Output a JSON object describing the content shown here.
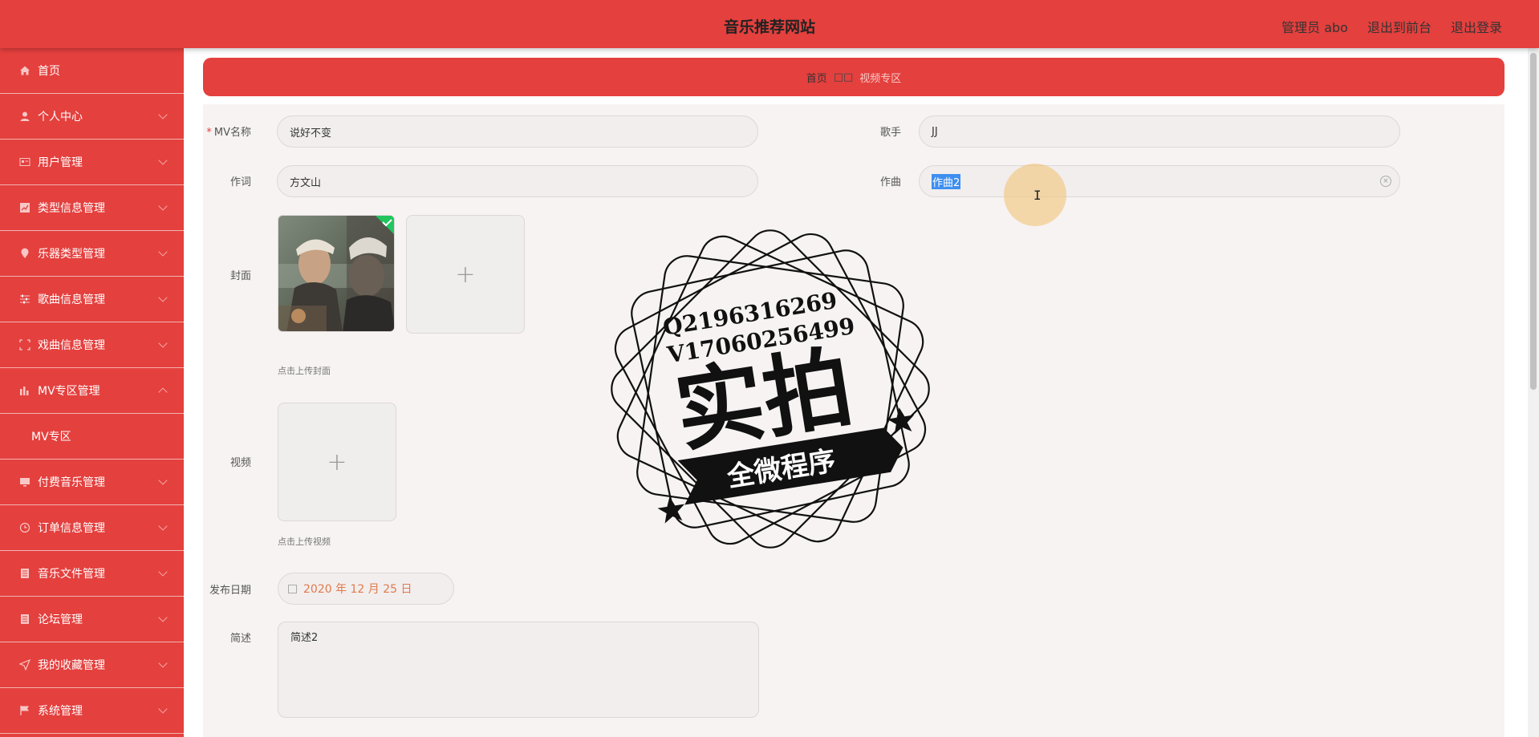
{
  "header": {
    "title": "音乐推荐网站",
    "admin": "管理员 abo",
    "to_front": "退出到前台",
    "logout": "退出登录"
  },
  "sidebar": {
    "items": [
      {
        "label": "首页",
        "icon": "home-icon"
      },
      {
        "label": "个人中心",
        "icon": "user-icon"
      },
      {
        "label": "用户管理",
        "icon": "id-card-icon"
      },
      {
        "label": "类型信息管理",
        "icon": "chart-icon"
      },
      {
        "label": "乐器类型管理",
        "icon": "location-icon"
      },
      {
        "label": "歌曲信息管理",
        "icon": "sliders-icon"
      },
      {
        "label": "戏曲信息管理",
        "icon": "fullscreen-icon"
      },
      {
        "label": "MV专区管理",
        "icon": "bar-chart-icon"
      },
      {
        "label": "MV专区",
        "icon": ""
      },
      {
        "label": "付费音乐管理",
        "icon": "monitor-icon"
      },
      {
        "label": "订单信息管理",
        "icon": "clock-icon"
      },
      {
        "label": "音乐文件管理",
        "icon": "document-icon"
      },
      {
        "label": "论坛管理",
        "icon": "document-icon"
      },
      {
        "label": "我的收藏管理",
        "icon": "send-icon"
      },
      {
        "label": "系统管理",
        "icon": "flag-icon"
      }
    ]
  },
  "breadcrumb": {
    "home": "首页",
    "separator": "□□",
    "current": "视频专区"
  },
  "form": {
    "mv_name_label": "MV名称",
    "mv_name_required": "*",
    "mv_name_value": "说好不变",
    "singer_label": "歌手",
    "singer_value": "JJ",
    "lyricist_label": "作词",
    "lyricist_value": "方文山",
    "composer_label": "作曲",
    "composer_value": "作曲2",
    "cover_label": "封面",
    "cover_tip": "点击上传封面",
    "video_label": "视频",
    "video_tip": "点击上传视频",
    "date_label": "发布日期",
    "date_value": "2020 年 12 月 25 日",
    "desc_label": "简述",
    "desc_value": "简述2"
  },
  "watermark": {
    "line1": "Q2196316269",
    "line2": "V17060256499",
    "main": "实拍",
    "ribbon": "全微程序"
  },
  "colors": {
    "primary": "#e4403e",
    "panel": "#f7f3f3",
    "date_text": "#e07a4c"
  }
}
